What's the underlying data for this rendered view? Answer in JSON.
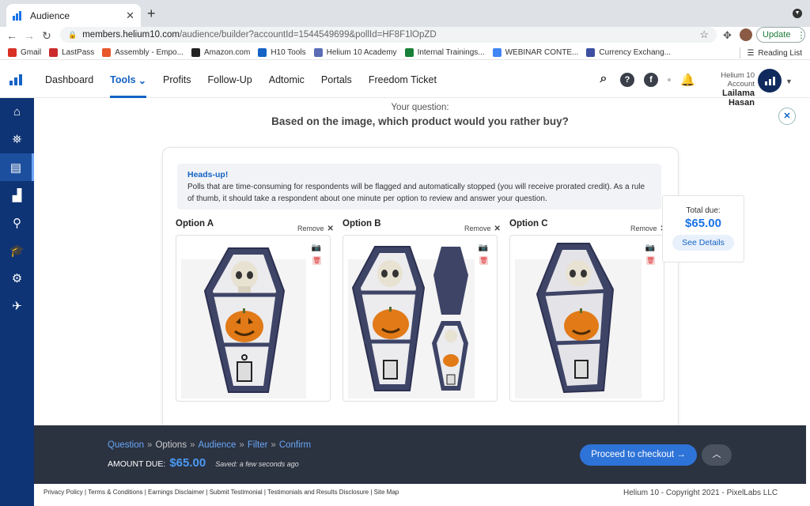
{
  "browser": {
    "tab_title": "Audience",
    "url_host": "members.helium10.com",
    "url_path": "/audience/builder?accountId=1544549699&pollId=HF8F1lOpZD",
    "update_label": "Update",
    "bookmarks": [
      "Gmail",
      "LastPass",
      "Assembly - Empo...",
      "Amazon.com",
      "H10 Tools",
      "Helium 10 Academy",
      "Internal Trainings...",
      "WEBINAR CONTE...",
      "Currency Exchang..."
    ],
    "bookmark_colors": [
      "#d93025",
      "#cc2b2b",
      "#e8562a",
      "#222222",
      "#1463c5",
      "#5a6cb5",
      "#188038",
      "#4285f4",
      "#3c4fa0"
    ],
    "reading_list": "Reading List"
  },
  "header": {
    "nav": [
      "Dashboard",
      "Tools",
      "Profits",
      "Follow-Up",
      "Adtomic",
      "Portals",
      "Freedom Ticket"
    ],
    "active_nav": "Tools",
    "account_label": "Helium 10 Account",
    "account_name": "Lailama Hasan",
    "help_icon_text": "?",
    "facebook_icon_text": "f"
  },
  "main": {
    "question_label": "Your question:",
    "question": "Based on the image, which product would you rather buy?",
    "heads_up_title": "Heads-up!",
    "heads_up_text": "Polls that are time-consuming for respondents will be flagged and automatically stopped (you will receive prorated credit). As a rule of thumb, it should take a respondent about one minute per option to review and answer your question.",
    "options": [
      {
        "title": "Option A",
        "remove": "Remove"
      },
      {
        "title": "Option B",
        "remove": "Remove"
      },
      {
        "title": "Option C",
        "remove": "Remove"
      }
    ],
    "total_label": "Total due:",
    "total_amount": "$65.00",
    "see_details": "See Details"
  },
  "stepbar": {
    "steps": [
      "Question",
      "Options",
      "Audience",
      "Filter",
      "Confirm"
    ],
    "current_step": "Options",
    "amount_label": "AMOUNT DUE:",
    "amount_value": "$65.00",
    "saved": "Saved: a few seconds ago",
    "checkout": "Proceed to checkout"
  },
  "footer": {
    "links": "Privacy Policy | Terms & Conditions | Earnings Disclaimer | Submit Testimonial | Testimonials and Results Disclosure | Site Map",
    "copyright": "Helium 10 - Copyright 2021 - PixelLabs LLC"
  },
  "colors": {
    "accent": "#1463c5",
    "sidebar": "#0e3475",
    "stepbar": "#2b3240",
    "checkout": "#2e73d8"
  }
}
